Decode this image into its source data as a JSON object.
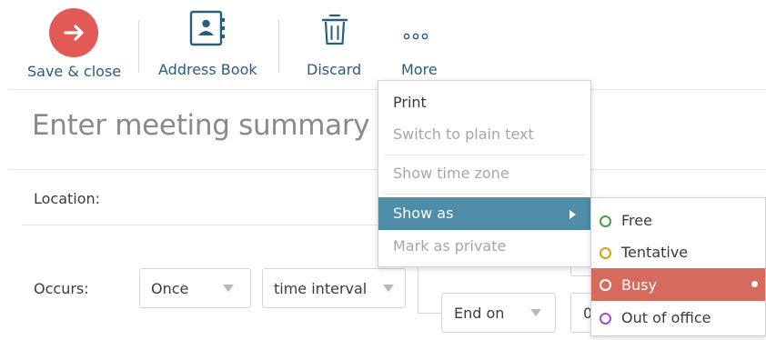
{
  "toolbar": {
    "save_close_label": "Save & close",
    "address_book_label": "Address Book",
    "discard_label": "Discard",
    "more_label": "More"
  },
  "form": {
    "summary_placeholder": "Enter meeting summary",
    "location_label": "Location:",
    "occurs_label": "Occurs:",
    "occurs_value": "Once",
    "interval_value": "time interval",
    "end_label": "End on",
    "partial_box_text": "0"
  },
  "more_menu": {
    "items": [
      {
        "label": "Print",
        "state": "enabled"
      },
      {
        "label": "Switch to plain text",
        "state": "disabled"
      },
      {
        "label": "Show time zone",
        "state": "disabled"
      },
      {
        "label": "Show as",
        "state": "highlighted"
      },
      {
        "label": "Mark as private",
        "state": "disabled"
      }
    ],
    "highlight_color": "#4e8ca8"
  },
  "show_as_menu": {
    "items": [
      {
        "label": "Free",
        "color": "#4b9b4b",
        "selected": false
      },
      {
        "label": "Tentative",
        "color": "#d4a017",
        "selected": false
      },
      {
        "label": "Busy",
        "color": "#e15a55",
        "selected": true
      },
      {
        "label": "Out of office",
        "color": "#a34cc2",
        "selected": false
      }
    ],
    "selected_bg": "#d56a5d"
  },
  "colors": {
    "accent_link": "#2a5d7c",
    "save_button": "#e15a55"
  }
}
